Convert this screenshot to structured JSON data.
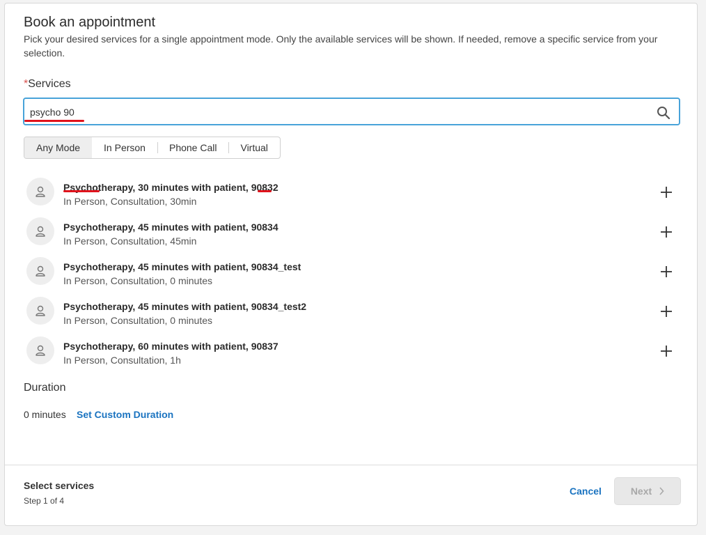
{
  "header": {
    "title": "Book an appointment",
    "subtitle": "Pick your desired services for a single appointment mode. Only the available services will be shown. If needed, remove a specific service from your selection."
  },
  "services_field": {
    "required_marker": "*",
    "label": "Services",
    "search_value": "psycho 90",
    "search_icon": "search-icon"
  },
  "mode_tabs": [
    {
      "label": "Any Mode",
      "active": true
    },
    {
      "label": "In Person",
      "active": false
    },
    {
      "label": "Phone Call",
      "active": false
    },
    {
      "label": "Virtual",
      "active": false
    }
  ],
  "services": [
    {
      "name": "Psychotherapy, 30 minutes with patient, 90832",
      "details": "In Person, Consultation, 30min"
    },
    {
      "name": "Psychotherapy, 45 minutes with patient, 90834",
      "details": "In Person, Consultation, 45min"
    },
    {
      "name": "Psychotherapy, 45 minutes with patient, 90834_test",
      "details": "In Person, Consultation, 0 minutes"
    },
    {
      "name": "Psychotherapy, 45 minutes with patient, 90834_test2",
      "details": "In Person, Consultation, 0 minutes"
    },
    {
      "name": "Psychotherapy, 60 minutes with patient, 90837",
      "details": "In Person, Consultation, 1h"
    }
  ],
  "duration": {
    "title": "Duration",
    "value": "0 minutes",
    "custom_link": "Set Custom Duration"
  },
  "footer": {
    "title": "Select services",
    "step": "Step 1 of 4",
    "cancel_label": "Cancel",
    "next_label": "Next"
  },
  "colors": {
    "accent": "#1a73c0",
    "focus_border": "#48a3d9",
    "annotation_red": "#e0131c",
    "disabled_bg": "#e8e8e8"
  }
}
